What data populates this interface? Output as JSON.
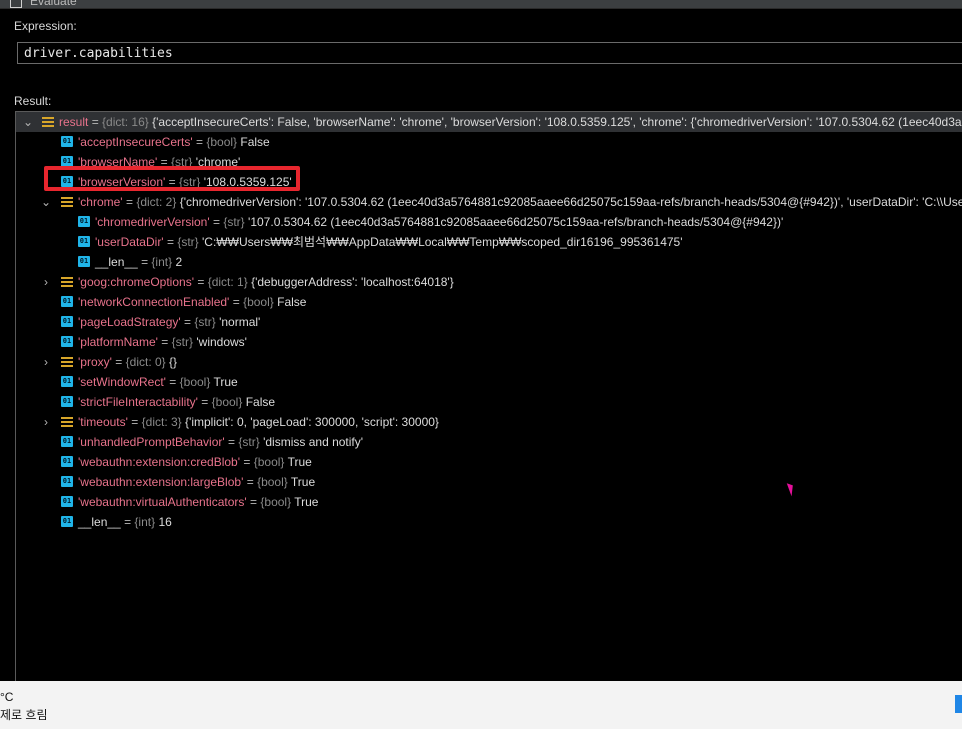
{
  "window": {
    "title": "Evaluate"
  },
  "expression": {
    "label": "Expression:",
    "value": "driver.capabilities"
  },
  "result": {
    "label": "Result:",
    "rows": [
      {
        "key": "result",
        "type": "{dict: 16}",
        "value": "{'acceptInsecureCerts': False, 'browserName': 'chrome', 'browserVersion': '108.0.5359.125', 'chrome': {'chromedriverVersion': '107.0.5304.62 (1eec40d3a5764881c92085aaee66d25075c159aa-refs/branch-heads/5304@{#942})', 'userDataDir': 'C:",
        "icon": "dict-icon",
        "caret": "down",
        "selected": true
      },
      {
        "key": "'acceptInsecureCerts'",
        "type": "{bool}",
        "value": "False",
        "icon": "scalar-icon"
      },
      {
        "key": "'browserName'",
        "type": "{str}",
        "value": "'chrome'",
        "icon": "scalar-icon"
      },
      {
        "key": "'browserVersion'",
        "type": "{str}",
        "value": "'108.0.5359.125'",
        "icon": "scalar-icon",
        "highlighted": true
      },
      {
        "key": "'chrome'",
        "type": "{dict: 2}",
        "value": "{'chromedriverVersion': '107.0.5304.62 (1eec40d3a5764881c92085aaee66d25075c159aa-refs/branch-heads/5304@{#942})', 'userDataDir': 'C:\\\\Users\\\\최범석",
        "icon": "dict-icon",
        "caret": "down"
      },
      {
        "key": "'chromedriverVersion'",
        "type": "{str}",
        "value": "'107.0.5304.62 (1eec40d3a5764881c92085aaee66d25075c159aa-refs/branch-heads/5304@{#942})'",
        "icon": "scalar-icon"
      },
      {
        "key": "'userDataDir'",
        "type": "{str}",
        "value": "'C:₩₩Users₩₩최범석₩₩AppData₩₩Local₩₩Temp₩₩scoped_dir16196_995361475'",
        "icon": "scalar-icon"
      },
      {
        "key": "__len__",
        "type": "{int}",
        "value": "2",
        "icon": "scalar-icon",
        "plain_key": true
      },
      {
        "key": "'goog:chromeOptions'",
        "type": "{dict: 1}",
        "value": "{'debuggerAddress': 'localhost:64018'}",
        "icon": "dict-icon",
        "caret": "right"
      },
      {
        "key": "'networkConnectionEnabled'",
        "type": "{bool}",
        "value": "False",
        "icon": "scalar-icon"
      },
      {
        "key": "'pageLoadStrategy'",
        "type": "{str}",
        "value": "'normal'",
        "icon": "scalar-icon"
      },
      {
        "key": "'platformName'",
        "type": "{str}",
        "value": "'windows'",
        "icon": "scalar-icon"
      },
      {
        "key": "'proxy'",
        "type": "{dict: 0}",
        "value": "{}",
        "icon": "dict-icon",
        "caret": "right"
      },
      {
        "key": "'setWindowRect'",
        "type": "{bool}",
        "value": "True",
        "icon": "scalar-icon"
      },
      {
        "key": "'strictFileInteractability'",
        "type": "{bool}",
        "value": "False",
        "icon": "scalar-icon"
      },
      {
        "key": "'timeouts'",
        "type": "{dict: 3}",
        "value": "{'implicit': 0, 'pageLoad': 300000, 'script': 30000}",
        "icon": "dict-icon",
        "caret": "right"
      },
      {
        "key": "'unhandledPromptBehavior'",
        "type": "{str}",
        "value": "'dismiss and notify'",
        "icon": "scalar-icon"
      },
      {
        "key": "'webauthn:extension:credBlob'",
        "type": "{bool}",
        "value": "True",
        "icon": "scalar-icon"
      },
      {
        "key": "'webauthn:extension:largeBlob'",
        "type": "{bool}",
        "value": "True",
        "icon": "scalar-icon"
      },
      {
        "key": "'webauthn:virtualAuthenticators'",
        "type": "{bool}",
        "value": "True",
        "icon": "scalar-icon"
      },
      {
        "key": "__len__",
        "type": "{int}",
        "value": "16",
        "icon": "scalar-icon",
        "plain_key": true
      }
    ]
  },
  "icons": {
    "scalar_glyph": "01"
  },
  "taskbar": {
    "temperature_unit": "°C",
    "weather_text": "제로 흐림"
  },
  "colors": {
    "highlight": "#e8262e",
    "key": "#e8738c",
    "scalar_icon": "#20b5e9",
    "dict_icon": "#d8a62a"
  }
}
